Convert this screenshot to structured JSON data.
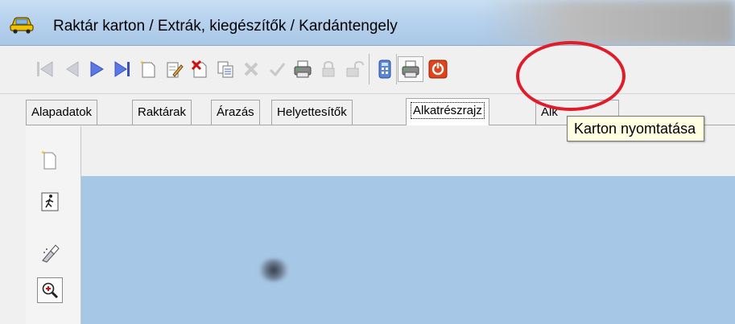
{
  "window": {
    "title": "Raktár karton / Extrák, kiegészítők / Kardántengely"
  },
  "toolbar": {
    "buttons": [
      {
        "name": "first-record",
        "icon": "first-icon",
        "enabled": false
      },
      {
        "name": "prev-record",
        "icon": "prev-icon",
        "enabled": false
      },
      {
        "name": "next-record",
        "icon": "next-icon",
        "enabled": true
      },
      {
        "name": "last-record",
        "icon": "last-icon",
        "enabled": true
      },
      {
        "name": "new-record",
        "icon": "new-document-icon",
        "enabled": true
      },
      {
        "name": "edit-record",
        "icon": "edit-icon",
        "enabled": true
      },
      {
        "name": "delete-record",
        "icon": "delete-icon",
        "enabled": true
      },
      {
        "name": "copy-record",
        "icon": "copy-icon",
        "enabled": true
      },
      {
        "name": "cancel",
        "icon": "cancel-icon",
        "enabled": false
      },
      {
        "name": "confirm",
        "icon": "check-icon",
        "enabled": false
      },
      {
        "name": "print-list",
        "icon": "printer-icon",
        "enabled": true
      },
      {
        "name": "lock",
        "icon": "lock-icon",
        "enabled": false
      },
      {
        "name": "unlock",
        "icon": "unlock-icon",
        "enabled": false
      },
      {
        "name": "calculator",
        "icon": "calculator-icon",
        "enabled": true
      },
      {
        "name": "print-card",
        "icon": "printer-icon",
        "enabled": true
      },
      {
        "name": "close",
        "icon": "power-icon",
        "enabled": true
      }
    ]
  },
  "tabs": [
    {
      "label": "Alapadatok"
    },
    {
      "label": "Raktárak"
    },
    {
      "label": "Árazás"
    },
    {
      "label": "Helyettesítők"
    },
    {
      "label": "Alkatrészrajz",
      "active": true
    },
    {
      "label": "Alk"
    }
  ],
  "tooltip": {
    "text": "Karton nyomtatása"
  },
  "side_toolbar": {
    "buttons": [
      {
        "icon": "new-document-icon"
      },
      {
        "icon": "walking-figure-icon"
      },
      {
        "icon": "eraser-icon"
      },
      {
        "icon": "zoom-in-icon",
        "pressed": true
      }
    ]
  },
  "colors": {
    "canvas": "#a7c7e6",
    "highlight": "#e01b2a",
    "tooltip_bg": "#ffffe1"
  }
}
